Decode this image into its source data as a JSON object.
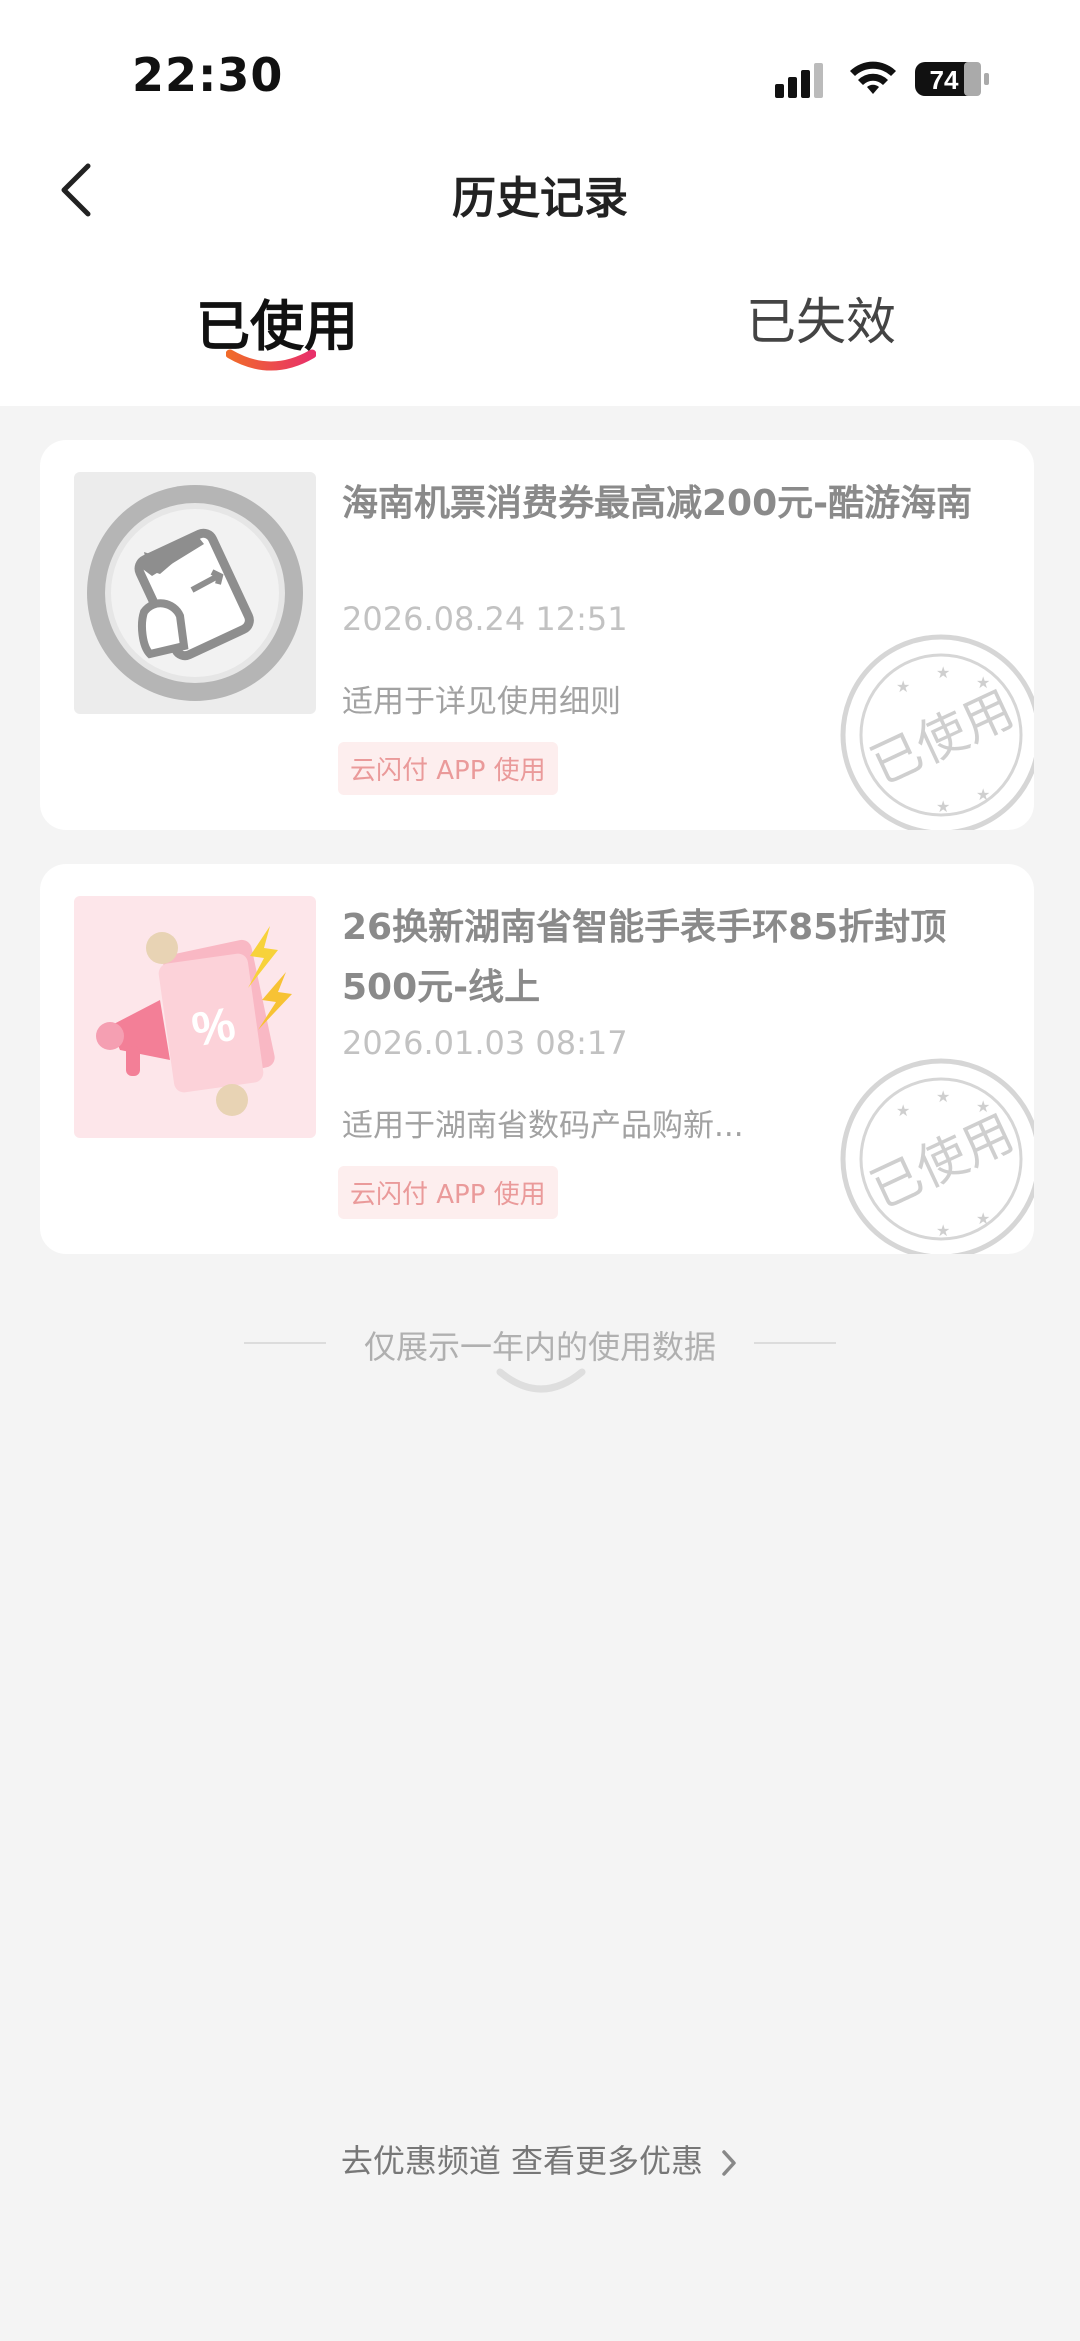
{
  "status_bar": {
    "time": "22:30",
    "battery": "74"
  },
  "header": {
    "title": "历史记录",
    "back_icon": "chevron-left-icon"
  },
  "tabs": [
    {
      "label": "已使用",
      "active": true
    },
    {
      "label": "已失效",
      "active": false
    }
  ],
  "coupons": [
    {
      "title": "海南机票消费券最高减200元-酷游海南",
      "date": "2026.08.24 12:51",
      "description": "适用于详见使用细则",
      "tag": "云闪付 APP 使用",
      "stamp": "已使用",
      "thumb_icon": "airplane-ticket-icon"
    },
    {
      "title": "26换新湖南省智能手表手环85折封顶500元-线上",
      "date": "2026.01.03 08:17",
      "description": "适用于湖南省数码产品购新...",
      "tag": "云闪付 APP 使用",
      "stamp": "已使用",
      "thumb_icon": "discount-megaphone-icon"
    }
  ],
  "footer": {
    "note": "仅展示一年内的使用数据",
    "more_link": "去优惠频道 查看更多优惠"
  },
  "colors": {
    "accent": "#f0484e",
    "tag_bg": "#fdeeee",
    "tag_text": "#ea9a9a"
  }
}
